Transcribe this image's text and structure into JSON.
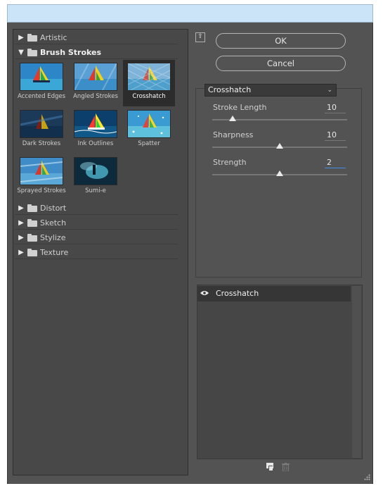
{
  "categories_top": [
    {
      "label": "Artistic",
      "expanded": false
    },
    {
      "label": "Brush Strokes",
      "expanded": true
    }
  ],
  "thumbnails": [
    {
      "label": "Accented Edges",
      "selected": false
    },
    {
      "label": "Angled Strokes",
      "selected": false
    },
    {
      "label": "Crosshatch",
      "selected": true
    },
    {
      "label": "Dark Strokes",
      "selected": false
    },
    {
      "label": "Ink Outlines",
      "selected": false
    },
    {
      "label": "Spatter",
      "selected": false
    },
    {
      "label": "Sprayed Strokes",
      "selected": false
    },
    {
      "label": "Sumi-e",
      "selected": false
    }
  ],
  "categories_bottom": [
    {
      "label": "Distort",
      "expanded": false
    },
    {
      "label": "Sketch",
      "expanded": false
    },
    {
      "label": "Stylize",
      "expanded": false
    },
    {
      "label": "Texture",
      "expanded": false
    }
  ],
  "buttons": {
    "ok": "OK",
    "cancel": "Cancel",
    "collapse_glyph": "⇧"
  },
  "filter_select": {
    "value": "Crosshatch"
  },
  "params": [
    {
      "label": "Stroke Length",
      "value": "10",
      "level": 0.15,
      "active": false
    },
    {
      "label": "Sharpness",
      "value": "10",
      "level": 0.5,
      "active": false
    },
    {
      "label": "Strength",
      "value": "2",
      "level": 0.5,
      "active": true
    }
  ],
  "layers": [
    {
      "name": "Crosshatch",
      "visible": true
    }
  ],
  "colors": {
    "dialog_bg": "#535353",
    "panel_bg": "#484848",
    "titlebar": "#cce4f7",
    "accent_focus": "#3d8fe0"
  },
  "icons": {
    "expand": "triangle-right-icon",
    "collapse": "triangle-down-icon",
    "folder": "folder-icon",
    "eye": "eye-icon",
    "new_layer": "new-effect-layer-icon",
    "delete": "trash-icon",
    "resize": "resize-grip-icon"
  }
}
